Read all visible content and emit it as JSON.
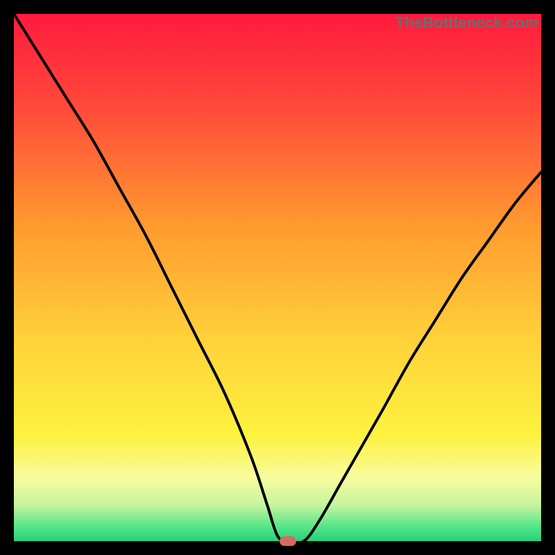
{
  "watermark": "TheBottleneck.com",
  "colors": {
    "frame_bg": "#000000",
    "curve": "#000000",
    "marker": "#d46a63",
    "gradient_stops": [
      {
        "offset": 0.0,
        "color": "#ff1a3d"
      },
      {
        "offset": 0.18,
        "color": "#ff4a3a"
      },
      {
        "offset": 0.4,
        "color": "#ff9a2f"
      },
      {
        "offset": 0.62,
        "color": "#ffd23a"
      },
      {
        "offset": 0.8,
        "color": "#fdf23f"
      },
      {
        "offset": 0.88,
        "color": "#f8fca0"
      },
      {
        "offset": 0.93,
        "color": "#c8f59e"
      },
      {
        "offset": 0.97,
        "color": "#5de68b"
      },
      {
        "offset": 1.0,
        "color": "#22d37a"
      }
    ]
  },
  "chart_data": {
    "type": "line",
    "title": "",
    "xlabel": "",
    "ylabel": "",
    "xlim": [
      0,
      100
    ],
    "ylim": [
      0,
      100
    ],
    "grid": false,
    "legend": false,
    "marker": {
      "x": 52,
      "y": 0
    },
    "series": [
      {
        "name": "bottleneck-curve",
        "x": [
          0,
          5,
          10,
          15,
          20,
          25,
          30,
          35,
          40,
          45,
          48,
          50,
          52,
          55,
          58,
          62,
          66,
          70,
          75,
          80,
          85,
          90,
          95,
          100
        ],
        "y": [
          100,
          92,
          84,
          76,
          67,
          58,
          48,
          38,
          28,
          16,
          7,
          1,
          0,
          0,
          4,
          11,
          18,
          25,
          34,
          42,
          50,
          57,
          64,
          70
        ]
      }
    ]
  }
}
